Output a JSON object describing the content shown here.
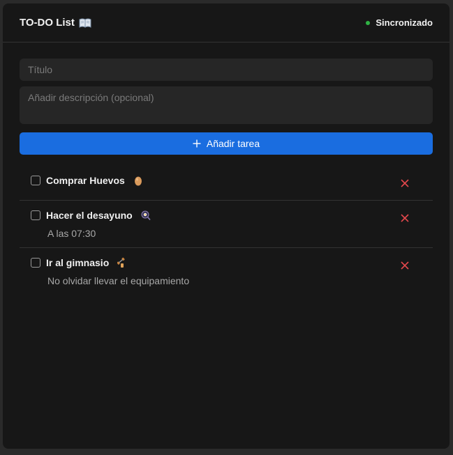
{
  "header": {
    "title": "TO-DO List",
    "title_icon": "book-icon",
    "status_label": "Sincronizado",
    "status_color": "#2fb344"
  },
  "form": {
    "title_placeholder": "Título",
    "title_value": "",
    "description_placeholder": "Añadir descripción (opcional)",
    "description_value": "",
    "add_button_label": "Añadir tarea",
    "add_button_icon": "plus-icon",
    "accent_color": "#1a6de0"
  },
  "tasks": [
    {
      "title": "Comprar Huevos",
      "icon": "egg-icon",
      "description": "",
      "done": false
    },
    {
      "title": "Hacer el desayuno",
      "icon": "frying-pan-icon",
      "description": "A las 07:30",
      "done": false
    },
    {
      "title": "Ir al gimnasio",
      "icon": "dumbbell-icon",
      "description": "No olvidar llevar el equipamiento",
      "done": false
    }
  ],
  "delete_color": "#e5484d"
}
